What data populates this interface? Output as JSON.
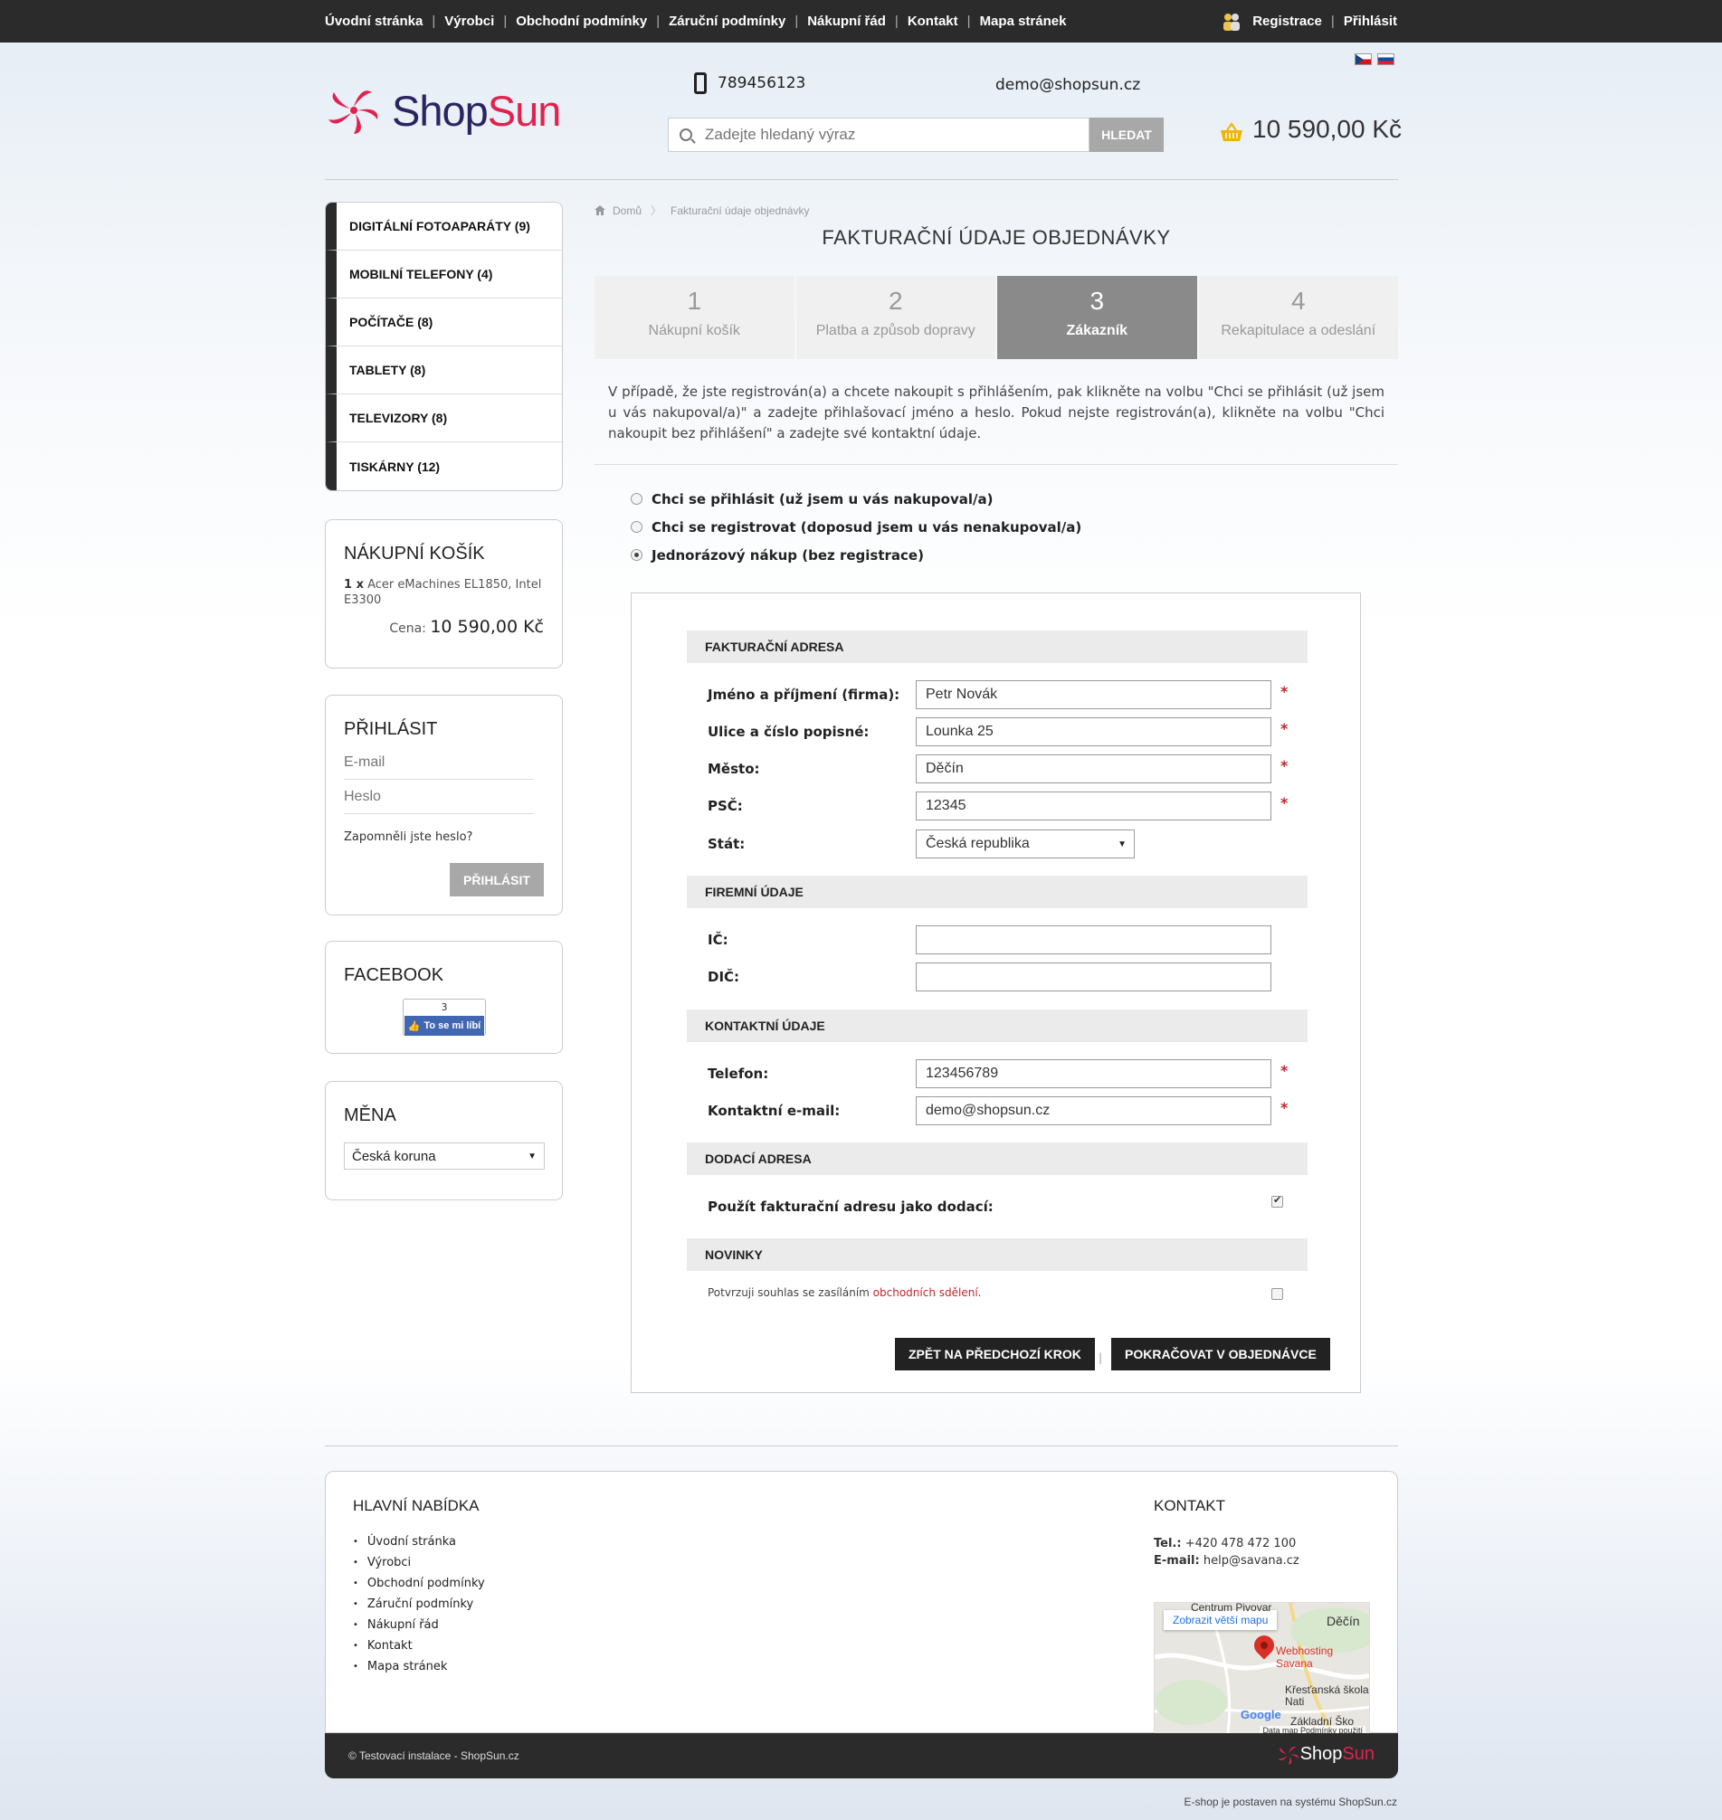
{
  "topnav": {
    "links": [
      "Úvodní stránka",
      "Výrobci",
      "Obchodní podmínky",
      "Záruční podmínky",
      "Nákupní řád",
      "Kontakt",
      "Mapa stránek"
    ],
    "register": "Registrace",
    "login": "Přihlásit"
  },
  "header": {
    "logo_shop": "Shop",
    "logo_sun": "Sun",
    "phone": "789456123",
    "email": "demo@shopsun.cz",
    "search_placeholder": "Zadejte hledaný výraz",
    "search_button": "HLEDAT",
    "cart_total": "10 590,00 Kč"
  },
  "sidebar": {
    "categories": [
      "DIGITÁLNÍ FOTOAPARÁTY (9)",
      "MOBILNÍ TELEFONY (4)",
      "POČÍTAČE (8)",
      "TABLETY (8)",
      "TELEVIZORY (8)",
      "TISKÁRNY (12)"
    ],
    "cart": {
      "title": "NÁKUPNÍ KOŠÍK",
      "qty": "1 x",
      "item": "Acer eMachines EL1850, Intel E3300",
      "price_label": "Cena:",
      "price": "10 590,00 Kč"
    },
    "login": {
      "title": "PŘIHLÁSIT",
      "email_placeholder": "E-mail",
      "password_placeholder": "Heslo",
      "forgot": "Zapomněli jste heslo?",
      "button": "PŘIHLÁSIT"
    },
    "facebook": {
      "title": "FACEBOOK",
      "count": "3",
      "like": "To se mi líbí"
    },
    "currency": {
      "title": "MĚNA",
      "selected": "Česká koruna"
    }
  },
  "main": {
    "breadcrumb_home": "Domů",
    "breadcrumb_current": "Fakturační údaje objednávky",
    "title": "FAKTURAČNÍ ÚDAJE OBJEDNÁVKY",
    "steps": [
      {
        "num": "1",
        "label": "Nákupní košík"
      },
      {
        "num": "2",
        "label": "Platba a způsob dopravy"
      },
      {
        "num": "3",
        "label": "Zákazník"
      },
      {
        "num": "4",
        "label": "Rekapitulace a odeslání"
      }
    ],
    "active_step": 3,
    "info": "V případě, že jste registrován(a) a chcete nakoupit s přihlášením, pak klikněte na volbu \"Chci se přihlásit (už jsem u vás nakupoval/a)\" a zadejte přihlašovací jméno a heslo. Pokud nejste registrován(a), klikněte na volbu \"Chci nakoupit bez přihlášení\" a zadejte své kontaktní údaje.",
    "radios": [
      {
        "label": "Chci se přihlásit (už jsem u vás nakupoval/a)",
        "checked": false
      },
      {
        "label": "Chci se registrovat (doposud jsem u vás nenakupoval/a)",
        "checked": false
      },
      {
        "label": "Jednorázový nákup (bez registrace)",
        "checked": true
      }
    ]
  },
  "form": {
    "billing_title": "FAKTURAČNÍ ADRESA",
    "name_label": "Jméno a příjmení (firma):",
    "name_value": "Petr Novák",
    "street_label": "Ulice a číslo popisné:",
    "street_value": "Lounka 25",
    "city_label": "Město:",
    "city_value": "Děčín",
    "zip_label": "PSČ:",
    "zip_value": "12345",
    "country_label": "Stát:",
    "country_value": "Česká republika",
    "company_title": "FIREMNÍ ÚDAJE",
    "ic_label": "IČ:",
    "ic_value": "",
    "dic_label": "DIČ:",
    "dic_value": "",
    "contact_title": "KONTAKTNÍ ÚDAJE",
    "phone_label": "Telefon:",
    "phone_value": "123456789",
    "email_label": "Kontaktní e-mail:",
    "email_value": "demo@shopsun.cz",
    "delivery_title": "DODACÍ ADRESA",
    "delivery_label": "Použít fakturační adresu jako dodací:",
    "delivery_checked": true,
    "news_title": "NOVINKY",
    "news_text": "Potvrzuji souhlas se zasíláním",
    "news_link": "obchodních sdělení",
    "news_checked": false,
    "back_button": "ZPĚT NA PŘEDCHOZÍ KROK",
    "next_button": "POKRAČOVAT V OBJEDNÁVCE",
    "required_mark": "*"
  },
  "footer": {
    "menu_title": "HLAVNÍ NABÍDKA",
    "menu": [
      "Úvodní stránka",
      "Výrobci",
      "Obchodní podmínky",
      "Záruční podmínky",
      "Nákupní řád",
      "Kontakt",
      "Mapa stránek"
    ],
    "contact_title": "KONTAKT",
    "tel_label": "Tel.:",
    "tel_value": "+420 478 472 100",
    "email_label": "E-mail:",
    "email_value": "help@savana.cz",
    "map_button": "Zobrazit větší mapu",
    "map_labels": [
      "Centrum Pivovar",
      "Děčín",
      "Webhosting Savana",
      "Křesťanská škola Nati",
      "Základní Ško",
      "Google"
    ],
    "map_footer": "Data map  Podmínky použití",
    "copyright": "© Testovací instalace - ShopSun.cz",
    "powered": "E-shop je postaven na systému ShopSun.cz"
  },
  "colors": {
    "topbar": "#2b2b2b",
    "brand_red": "#e0234e",
    "brand_navy": "#2a2560",
    "active_step": "#8a8a8a",
    "required": "#c0282e"
  }
}
